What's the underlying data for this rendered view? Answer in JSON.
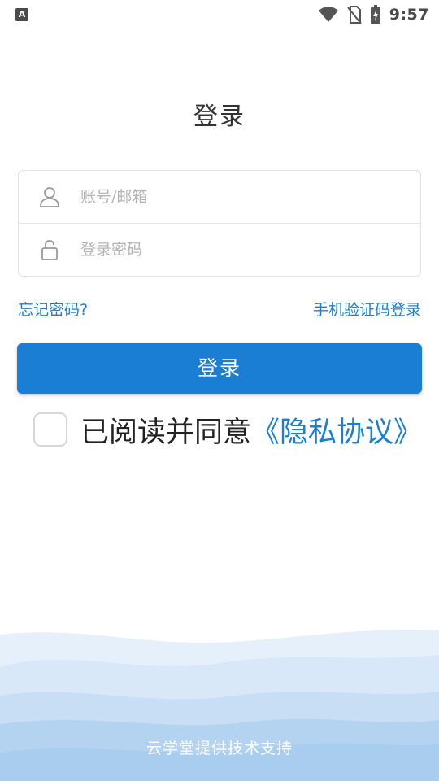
{
  "status_bar": {
    "left_icon": "accessibility-icon",
    "time": "9:57",
    "icons": [
      "wifi-icon",
      "no-sim-icon",
      "battery-charging-icon"
    ]
  },
  "page": {
    "title": "登录"
  },
  "form": {
    "account": {
      "icon": "user-icon",
      "placeholder": "账号/邮箱",
      "value": ""
    },
    "password": {
      "icon": "lock-icon",
      "placeholder": "登录密码",
      "value": ""
    }
  },
  "links": {
    "forgot_password": "忘记密码?",
    "sms_login": "手机验证码登录"
  },
  "login_button": {
    "label": "登录"
  },
  "agreement": {
    "checked": false,
    "text": "已阅读并同意",
    "link_text": "《隐私协议》"
  },
  "footer": {
    "text": "云学堂提供技术支持"
  },
  "colors": {
    "accent": "#1a7fd4",
    "wave_light": "#e6f0fb",
    "wave_mid": "#cfe2f6",
    "wave_dark": "#a9cdef"
  }
}
